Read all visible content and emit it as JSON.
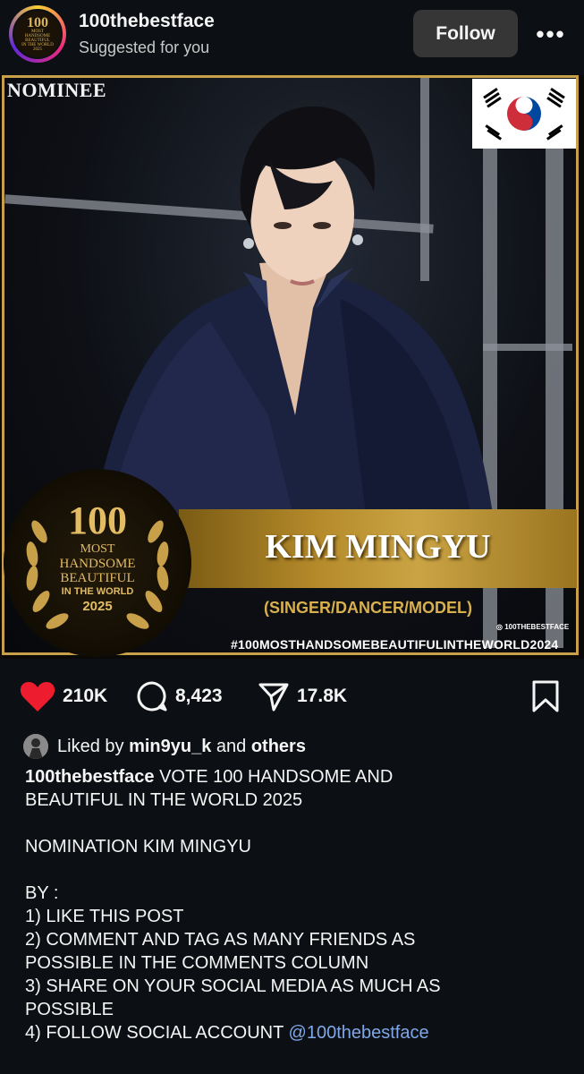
{
  "header": {
    "username": "100thebestface",
    "subtitle": "Suggested for you",
    "follow_label": "Follow",
    "more_label": "•••",
    "avatar": {
      "num": "100",
      "lines": [
        "MOST",
        "HANDSOME",
        "BEAUTIFUL",
        "IN THE WORLD",
        "2025"
      ]
    }
  },
  "post_image": {
    "corner_label": "NOMINEE",
    "name": "KIM MINGYU",
    "role": "(SINGER/DANCER/MODEL)",
    "handle_tag": "◎ 100THEBESTFACE",
    "hashtag": "#100MOSTHANDSOMEBEAUTIFULINTHEWORLD2024",
    "badge": {
      "num": "100",
      "line1": "MOST",
      "line2": "HANDSOME",
      "line3": "BEAUTIFUL",
      "line4": "IN THE WORLD",
      "year": "2025"
    },
    "colors": {
      "gold": "#c9a04a",
      "flag_red": "#cd2e3a",
      "flag_blue": "#0047a0"
    }
  },
  "actions": {
    "likes": "210K",
    "comments": "8,423",
    "shares": "17.8K",
    "like_color": "#ed1c2e"
  },
  "liked_by": {
    "prefix": "Liked by",
    "user": "min9yu_k",
    "middle": "and",
    "others": "others"
  },
  "caption": {
    "username": "100thebestface",
    "lines": [
      "VOTE 100 HANDSOME AND",
      "BEAUTIFUL IN THE WORLD 2025",
      "",
      "NOMINATION KIM MINGYU",
      "",
      "BY :",
      "1) LIKE THIS POST",
      "2) COMMENT AND TAG AS MANY FRIENDS AS",
      "POSSIBLE IN THE COMMENTS COLUMN",
      "3) SHARE ON YOUR SOCIAL MEDIA AS MUCH AS",
      "POSSIBLE",
      "4) FOLLOW SOCIAL ACCOUNT"
    ],
    "mention": "@100thebestface"
  }
}
